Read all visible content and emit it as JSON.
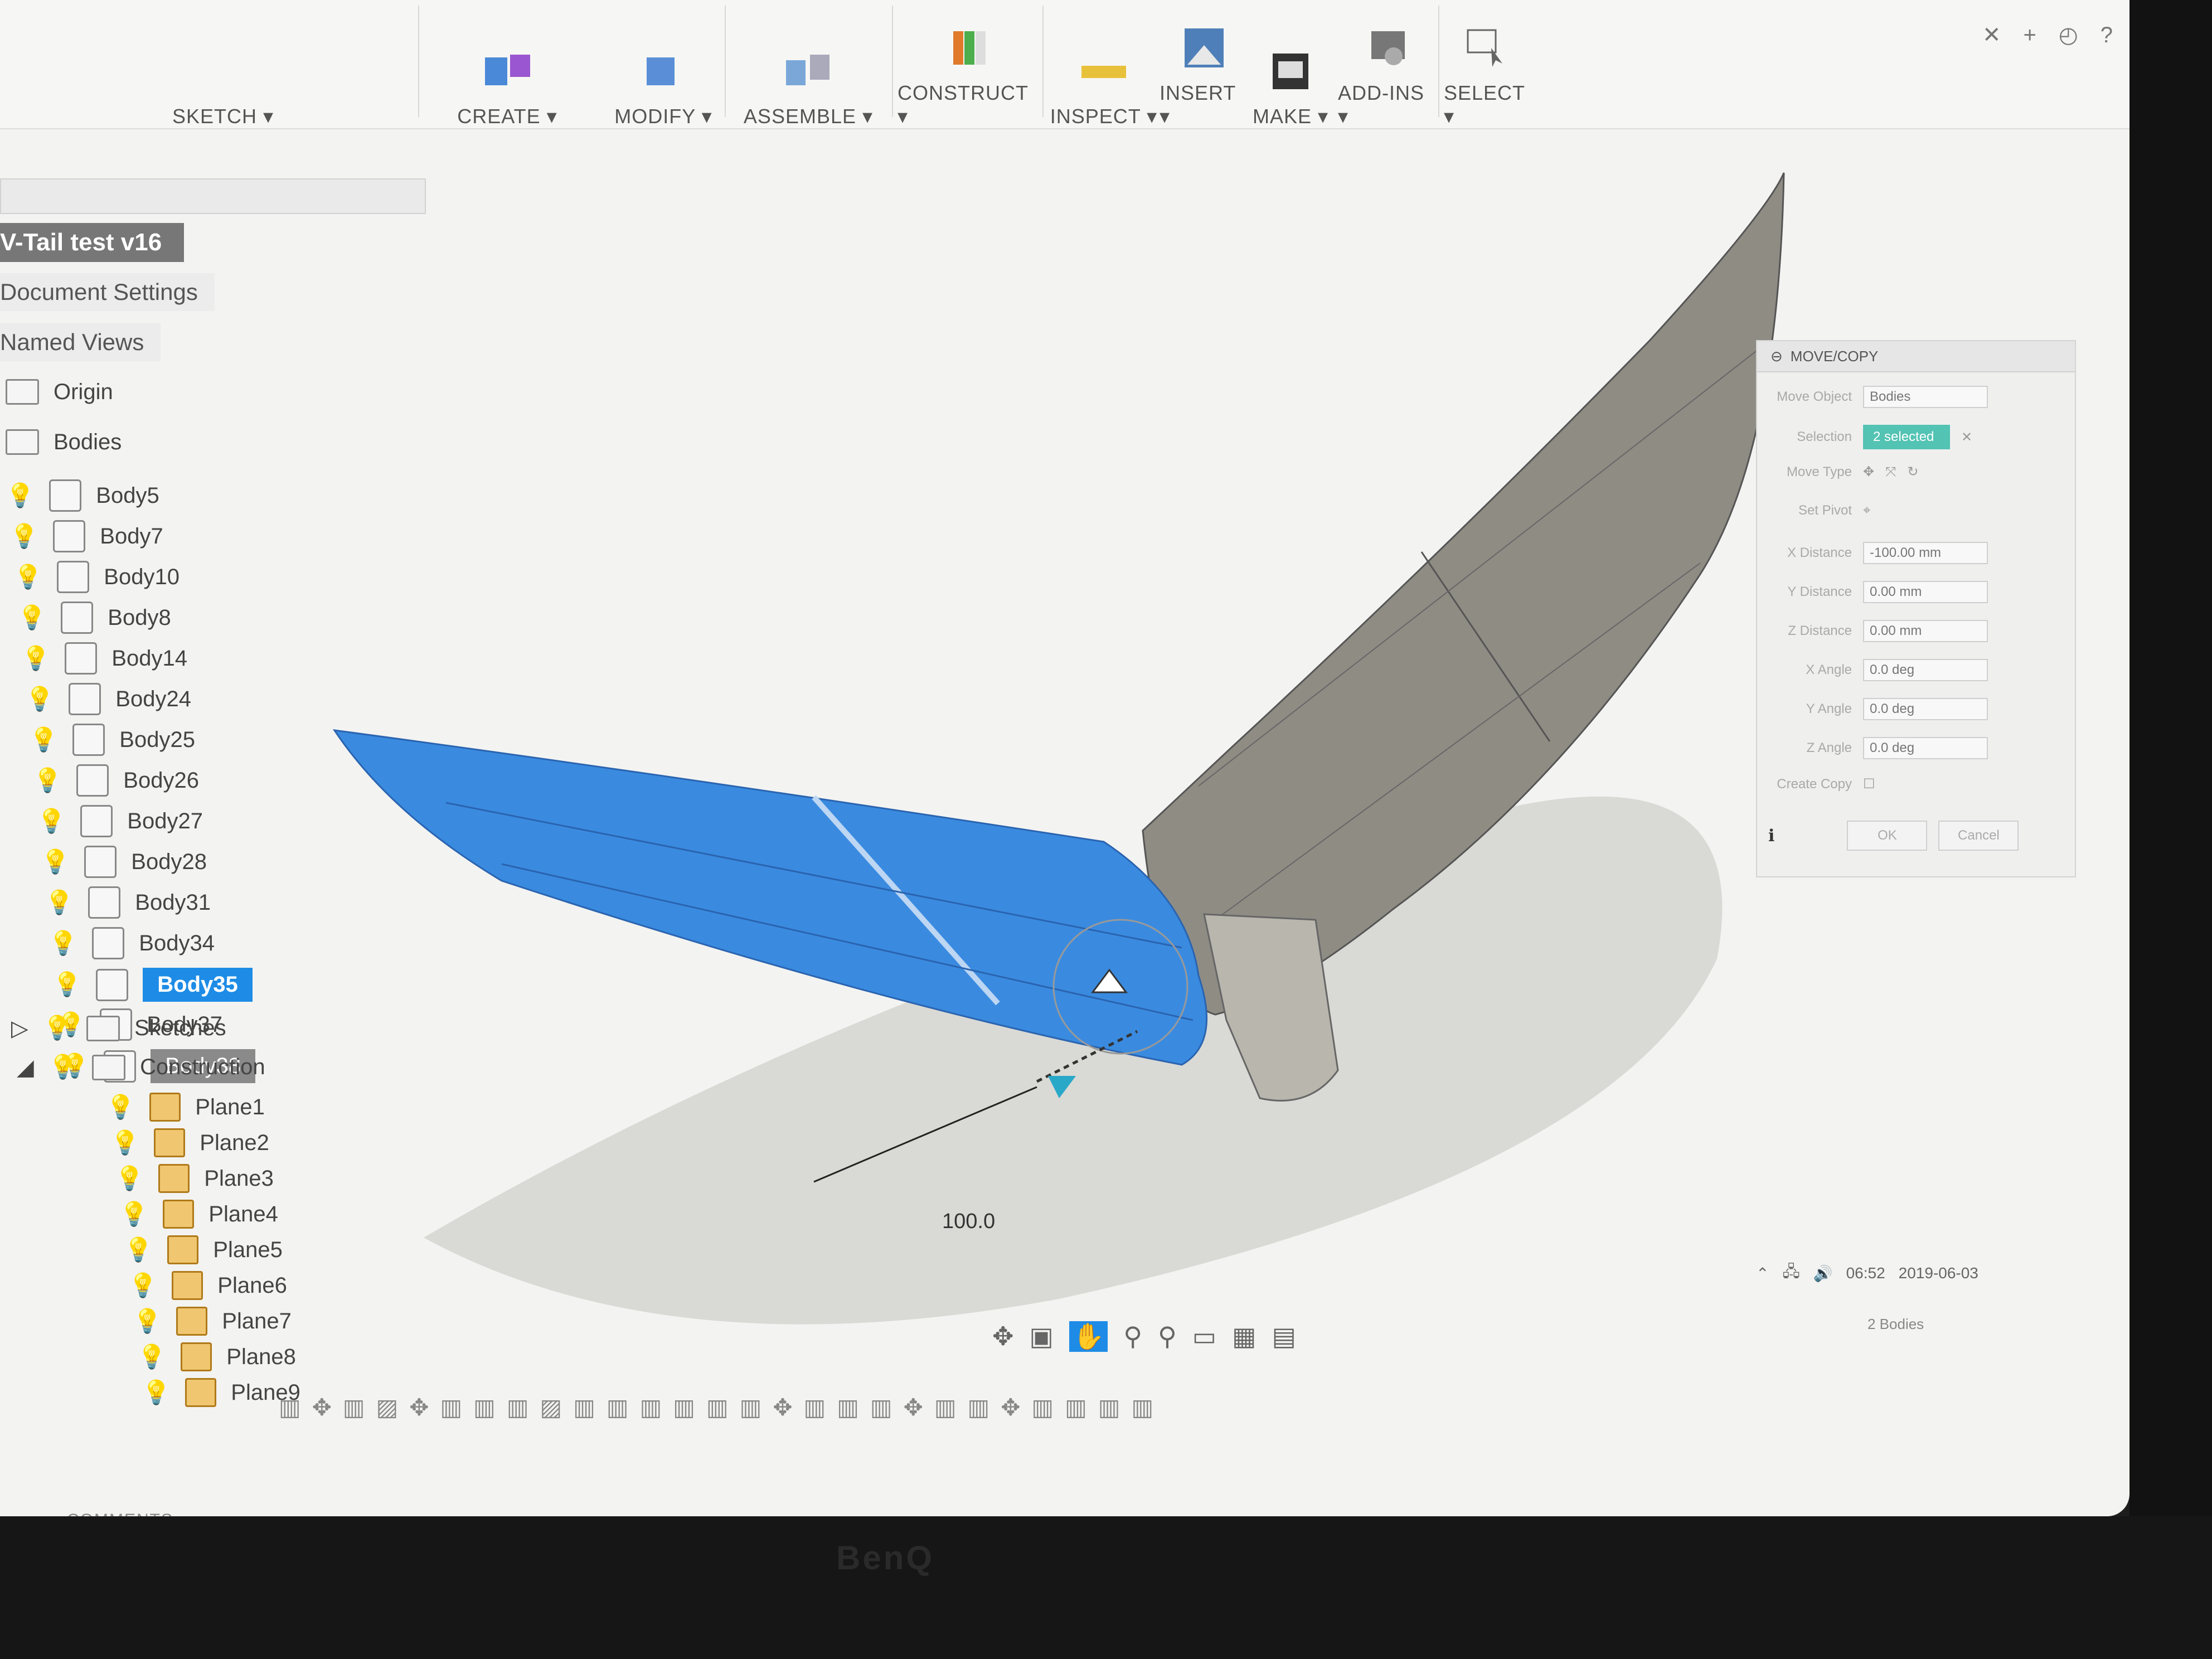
{
  "toolbar": {
    "sketch": "SKETCH ▾",
    "create": "CREATE ▾",
    "modify": "MODIFY ▾",
    "assemble": "ASSEMBLE ▾",
    "construct": "CONSTRUCT ▾",
    "inspect": "INSPECT ▾",
    "insert": "INSERT ▾",
    "make": "MAKE ▾",
    "addins": "ADD-INS ▾",
    "select": "SELECT ▾"
  },
  "browser": {
    "doc_title": "V-Tail test v16",
    "document_settings": "Document Settings",
    "named_views": "Named Views",
    "origin": "Origin",
    "bodies": "Bodies",
    "body_items": [
      "Body5",
      "Body7",
      "Body10",
      "Body8",
      "Body14",
      "Body24",
      "Body25",
      "Body26",
      "Body27",
      "Body28",
      "Body31",
      "Body34",
      "Body35",
      "Body37",
      "Body38"
    ],
    "sketches": "Sketches",
    "construction": "Construction",
    "planes": [
      "Plane1",
      "Plane2",
      "Plane3",
      "Plane4",
      "Plane5",
      "Plane6",
      "Plane7",
      "Plane8",
      "Plane9"
    ]
  },
  "viewport": {
    "dimension": "100.0"
  },
  "dialog": {
    "title": "MOVE/COPY",
    "move_object_label": "Move Object",
    "move_object_value": "Bodies",
    "selection_label": "Selection",
    "selection_value": "2 selected",
    "move_type_label": "Move Type",
    "set_pivot_label": "Set Pivot",
    "x_distance_label": "X Distance",
    "x_distance_value": "-100.00 mm",
    "y_distance_label": "Y Distance",
    "y_distance_value": "0.00 mm",
    "z_distance_label": "Z Distance",
    "z_distance_value": "0.00 mm",
    "x_angle_label": "X Angle",
    "x_angle_value": "0.0 deg",
    "y_angle_label": "Y Angle",
    "y_angle_value": "0.0 deg",
    "z_angle_label": "Z Angle",
    "z_angle_value": "0.0 deg",
    "create_copy_label": "Create Copy",
    "ok": "OK",
    "cancel": "Cancel"
  },
  "status": {
    "body_count": "2 Bodies",
    "time": "06:52",
    "date": "2019-06-03"
  },
  "comments": "COMMENTS",
  "monitor_brand": "BenQ",
  "colors": {
    "selected_blue": "#1e8ce6",
    "body_blue": "#3a8be0",
    "body_gray": "#8f8c84",
    "teal": "#53c3b3"
  }
}
